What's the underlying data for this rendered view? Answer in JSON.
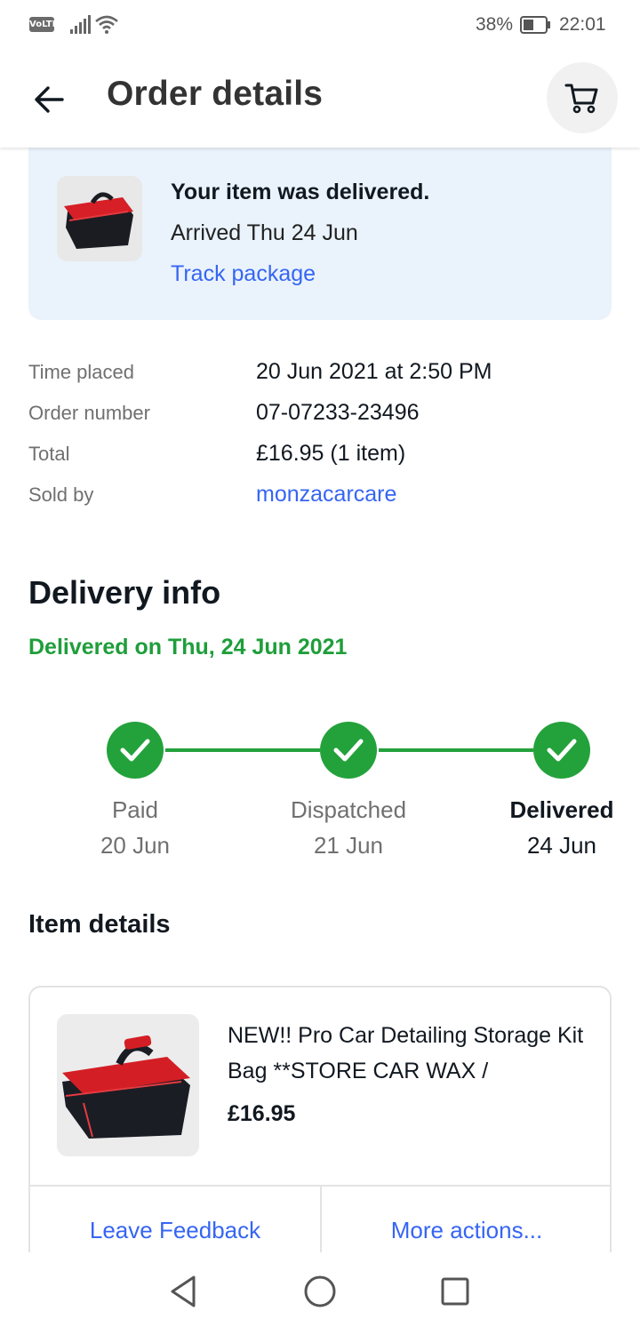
{
  "status_bar": {
    "network": "VoLTE",
    "battery": "38%",
    "time": "22:01"
  },
  "header": {
    "title": "Order details",
    "back_icon": "back-arrow-icon",
    "cart_icon": "shopping-cart-icon"
  },
  "delivery_card": {
    "headline": "Your item was delivered.",
    "arrived": "Arrived Thu 24 Jun",
    "track_link": "Track package"
  },
  "order_info": [
    {
      "label": "Time placed",
      "value": "20 Jun 2021 at 2:50 PM",
      "link": false
    },
    {
      "label": "Order number",
      "value": "07-07233-23496",
      "link": false
    },
    {
      "label": "Total",
      "value": "£16.95 (1 item)",
      "link": false
    },
    {
      "label": "Sold by",
      "value": "monzacarcare",
      "link": true
    }
  ],
  "delivery_info": {
    "title": "Delivery info",
    "status": "Delivered on Thu, 24 Jun 2021",
    "steps": [
      {
        "label": "Paid",
        "date": "20 Jun",
        "active": false
      },
      {
        "label": "Dispatched",
        "date": "21 Jun",
        "active": false
      },
      {
        "label": "Delivered",
        "date": "24 Jun",
        "active": true
      }
    ]
  },
  "item_details": {
    "title": "Item details",
    "item_title": "NEW!! Pro Car Detailing Storage Kit Bag **STORE CAR WAX /",
    "price": "£16.95",
    "actions": [
      "Leave Feedback",
      "More actions..."
    ]
  },
  "colors": {
    "accent_link": "#3665f3",
    "success_green": "#23a23b",
    "card_blue": "#eaf3fb"
  },
  "nav_bar": {
    "icons": [
      "back-triangle-icon",
      "home-circle-icon",
      "recents-square-icon"
    ]
  }
}
